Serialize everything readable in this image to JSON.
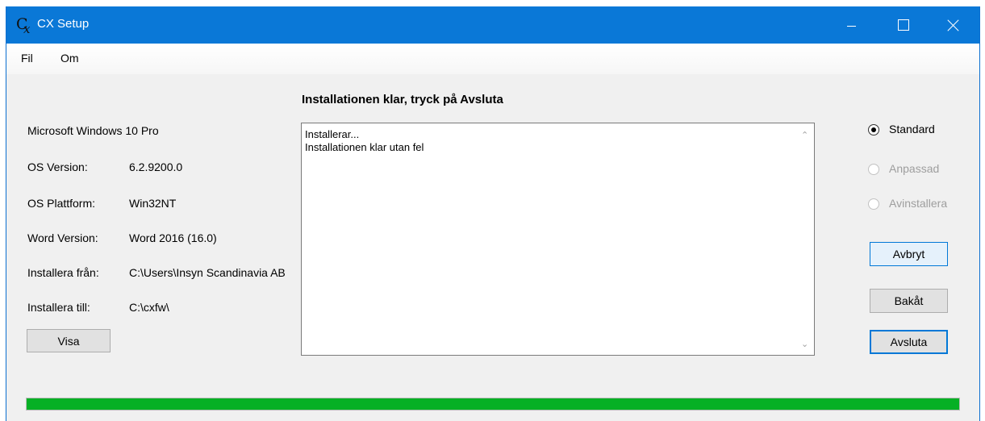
{
  "window": {
    "title": "CX Setup",
    "accent_color": "#0a78d7"
  },
  "menu": {
    "items": [
      {
        "label": "Fil"
      },
      {
        "label": "Om"
      }
    ]
  },
  "system_info": {
    "os_name": "Microsoft Windows 10 Pro",
    "rows": [
      {
        "label": "OS Version:",
        "value": "6.2.9200.0"
      },
      {
        "label": "OS Plattform:",
        "value": "Win32NT"
      },
      {
        "label": "Word Version:",
        "value": "Word 2016 (16.0)"
      },
      {
        "label": "Installera från:",
        "value": "C:\\Users\\Insyn Scandinavia AB"
      },
      {
        "label": "Installera till:",
        "value": "C:\\cxfw\\"
      }
    ],
    "show_button": "Visa"
  },
  "status": {
    "heading": "Installationen klar, tryck på Avsluta"
  },
  "log": {
    "lines": [
      "Installerar...",
      "Installationen klar utan fel"
    ]
  },
  "options": {
    "items": [
      {
        "label": "Standard",
        "checked": true,
        "enabled": true
      },
      {
        "label": "Anpassad",
        "checked": false,
        "enabled": false
      },
      {
        "label": "Avinstallera",
        "checked": false,
        "enabled": false
      }
    ]
  },
  "buttons": {
    "cancel": "Avbryt",
    "back": "Bakåt",
    "finish": "Avsluta"
  },
  "progress": {
    "value_percent": 100,
    "color": "#06b025"
  }
}
